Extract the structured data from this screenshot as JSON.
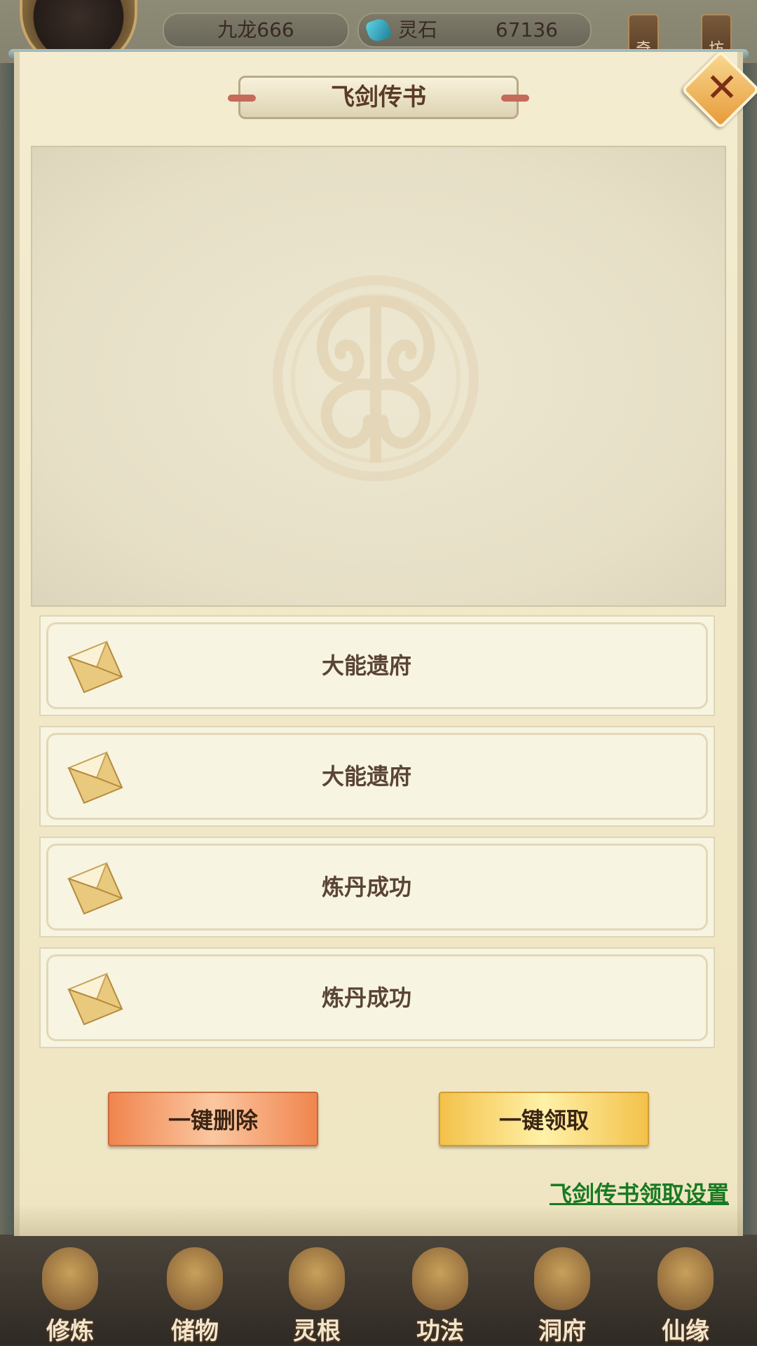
{
  "top_bar": {
    "player_name": "九龙666",
    "currency_label": "灵石",
    "currency_value": "67136",
    "side_tabs": [
      "奇",
      "坊"
    ]
  },
  "dialog": {
    "title": "飞剑传书",
    "close_icon": "close-x-icon",
    "mails": [
      {
        "title": "大能遗府",
        "icon": "envelope-icon"
      },
      {
        "title": "大能遗府",
        "icon": "envelope-icon"
      },
      {
        "title": "炼丹成功",
        "icon": "envelope-icon"
      },
      {
        "title": "炼丹成功",
        "icon": "envelope-icon"
      }
    ],
    "delete_all_label": "一键删除",
    "claim_all_label": "一键领取",
    "settings_link": "飞剑传书领取设置"
  },
  "bottom_nav": {
    "items": [
      {
        "label": "修炼"
      },
      {
        "label": "储物"
      },
      {
        "label": "灵根"
      },
      {
        "label": "功法"
      },
      {
        "label": "洞府"
      },
      {
        "label": "仙缘"
      }
    ]
  },
  "colors": {
    "panel_bg": "#f1e9c8",
    "link_green": "#187a22",
    "delete_orange": "#f0854e",
    "claim_gold": "#f3c14a"
  }
}
